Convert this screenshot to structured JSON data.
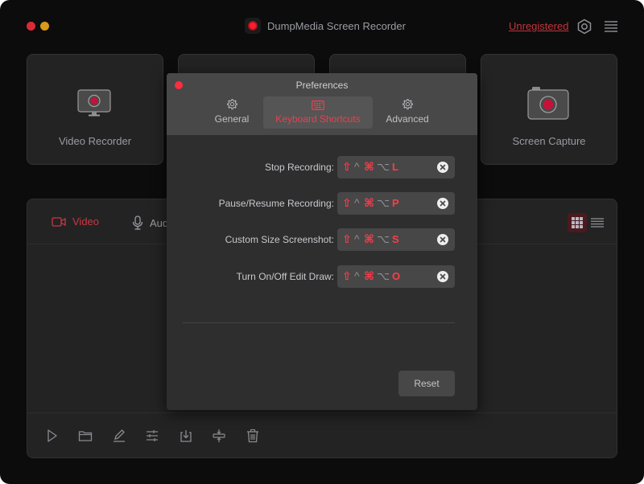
{
  "window": {
    "title": "DumpMedia Screen Recorder",
    "registration_link": "Unregistered",
    "header_icons": [
      "settings-icon",
      "menu-icon"
    ]
  },
  "cards": [
    {
      "label": "Video Recorder",
      "icon": "monitor-record-icon"
    },
    {
      "label": "",
      "icon": ""
    },
    {
      "label": "",
      "icon": ""
    },
    {
      "label": "Screen Capture",
      "icon": "camera-record-icon"
    }
  ],
  "panel": {
    "tabs": [
      {
        "label": "Video",
        "icon": "video-camera-icon",
        "active": true
      },
      {
        "label": "Audio",
        "icon": "microphone-icon",
        "active": false
      }
    ],
    "view_modes": [
      {
        "name": "grid-view",
        "active": true
      },
      {
        "name": "list-view",
        "active": false
      }
    ],
    "toolbar": [
      "play-icon",
      "folder-icon",
      "edit-icon",
      "adjust-icon",
      "export-icon",
      "merge-icon",
      "trash-icon"
    ]
  },
  "dialog": {
    "title": "Preferences",
    "tabs": [
      {
        "label": "General",
        "icon": "gear-icon",
        "active": false
      },
      {
        "label": "Keyboard Shortcuts",
        "icon": "keyboard-icon",
        "active": true
      },
      {
        "label": "Advanced",
        "icon": "gear-icon",
        "active": false
      }
    ],
    "modifier_symbols": {
      "shift": "⇧",
      "control": "^",
      "command": "⌘",
      "option": "⌥"
    },
    "shortcuts": [
      {
        "label": "Stop Recording:",
        "shift": true,
        "control": false,
        "command": true,
        "option": false,
        "key": "L"
      },
      {
        "label": "Pause/Resume Recording:",
        "shift": true,
        "control": false,
        "command": true,
        "option": false,
        "key": "P"
      },
      {
        "label": "Custom Size Screenshot:",
        "shift": true,
        "control": false,
        "command": true,
        "option": false,
        "key": "S"
      },
      {
        "label": "Turn On/Off Edit Draw:",
        "shift": true,
        "control": false,
        "command": true,
        "option": false,
        "key": "O"
      }
    ],
    "reset_label": "Reset"
  },
  "colors": {
    "accent": "#e8414d",
    "window_bg": "#0c0c0c",
    "card_bg": "#232323",
    "dialog_bg": "#2e2e2e",
    "dialog_header_bg": "#484848"
  }
}
